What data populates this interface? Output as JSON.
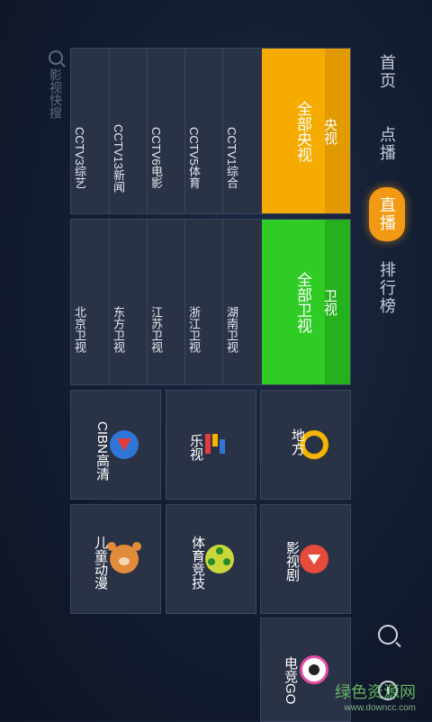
{
  "nav": {
    "items": [
      {
        "label": "首页"
      },
      {
        "label": "点播"
      },
      {
        "label": "直播",
        "active": true
      },
      {
        "label": "排行榜"
      }
    ]
  },
  "search_hint": "影视快搜",
  "cctv": {
    "title": "央视",
    "all": "全部央视",
    "channels": [
      "CCTV1综合",
      "CCTV5体育",
      "CCTV6电影",
      "CCTV13新闻",
      "CCTV3综艺"
    ]
  },
  "satellite": {
    "title": "卫视",
    "all": "全部卫视",
    "channels": [
      "湖南卫视",
      "浙江卫视",
      "江苏卫视",
      "东方卫视",
      "北京卫视"
    ]
  },
  "tiles": [
    {
      "label": "地方",
      "icon": "yellow-ring-icon",
      "color": "#f5b400"
    },
    {
      "label": "乐视",
      "icon": "letv-icon",
      "color": "#e53b3b"
    },
    {
      "label": "CIBN高清",
      "icon": "red-triangle-icon",
      "color": "#2f76d6"
    },
    {
      "label": "影视剧",
      "icon": "red-down-arrow-icon",
      "color": "#e54a3c"
    },
    {
      "label": "体育竞技",
      "icon": "soccer-ball-icon",
      "color": "#c9d73a"
    },
    {
      "label": "儿童动漫",
      "icon": "bear-icon",
      "color": "#e08c3a"
    },
    {
      "label": "电竞GO",
      "icon": "esports-mascot-icon",
      "color": "#e64aa7"
    }
  ],
  "watermark": {
    "big": "绿色资源网",
    "small": "www.downcc.com"
  }
}
